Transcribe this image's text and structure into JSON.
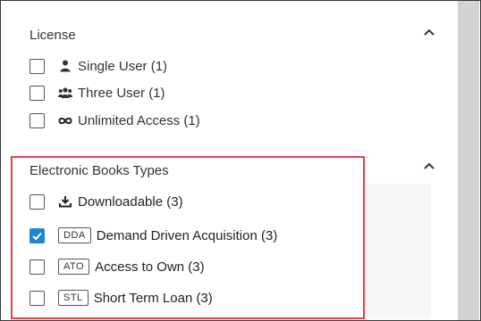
{
  "license": {
    "title": "License",
    "options": [
      {
        "label": "Single User (1)",
        "icon": "user-icon",
        "checked": false
      },
      {
        "label": "Three User (1)",
        "icon": "users-icon",
        "checked": false
      },
      {
        "label": "Unlimited Access (1)",
        "icon": "infinity-icon",
        "checked": false
      }
    ]
  },
  "ebook_types": {
    "title": "Electronic Books Types",
    "options": [
      {
        "badge": "",
        "label": "Downloadable (3)",
        "icon": "download-icon",
        "checked": false
      },
      {
        "badge": "DDA",
        "label": "Demand Driven Acquisition (3)",
        "checked": true
      },
      {
        "badge": "ATO",
        "label": "Access to Own (3)",
        "checked": false
      },
      {
        "badge": "STL",
        "label": "Short Term Loan (3)",
        "checked": false
      }
    ]
  },
  "colors": {
    "checkbox_checked": "#1f82d4",
    "highlight_border": "#e04444"
  }
}
